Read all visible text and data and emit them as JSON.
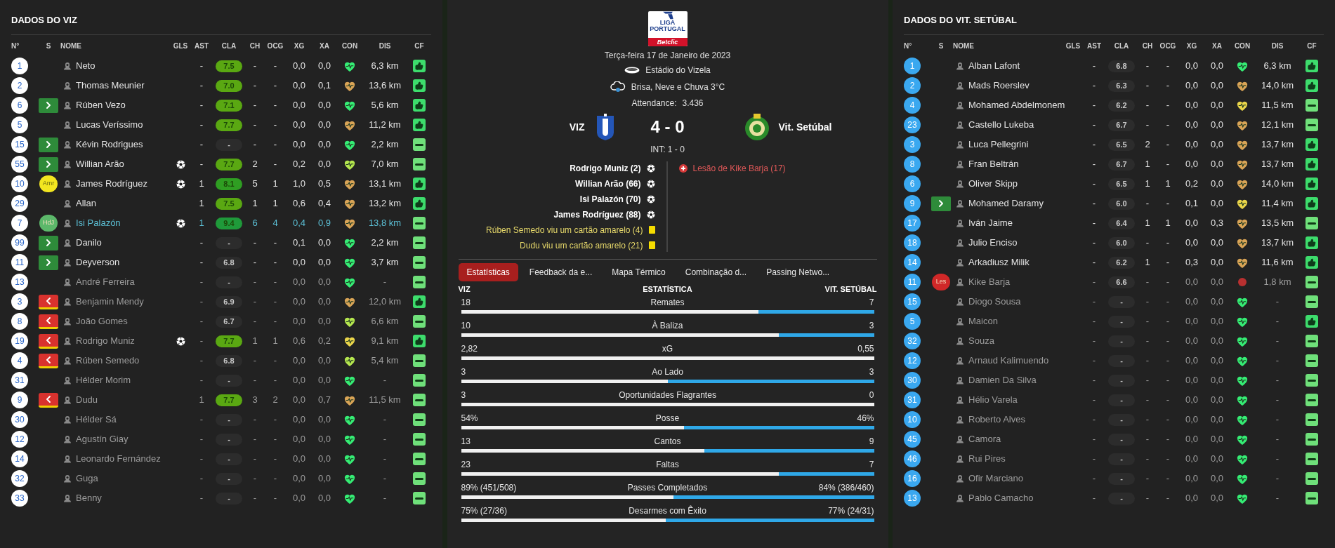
{
  "home_panel": {
    "title": "DADOS DO VIZ",
    "kind": "light",
    "columns": [
      "N°",
      "S",
      "NOME",
      "GLS",
      "AST",
      "CLA",
      "CH",
      "OCG",
      "XG",
      "XA",
      "CON",
      "DIS",
      "CF"
    ],
    "rows": [
      {
        "n": "1",
        "name": "Neto",
        "dimmed": false,
        "highlighted": false,
        "goal": false,
        "booked": false,
        "ast": "-",
        "rating": {
          "text": "7.5",
          "color": "#5aa812"
        },
        "ch": "-",
        "ocg": "-",
        "xg": "0,0",
        "xa": "0,0",
        "condition": {
          "kind": "fresh"
        },
        "dis": "6,3 km",
        "thumbs_up": true
      },
      {
        "n": "2",
        "name": "Thomas Meunier",
        "dimmed": false,
        "highlighted": false,
        "goal": false,
        "booked": false,
        "ast": "-",
        "rating": {
          "text": "7.0",
          "color": "#5aa812"
        },
        "ch": "-",
        "ocg": "-",
        "xg": "0,0",
        "xa": "0,1",
        "condition": {
          "kind": "tired"
        },
        "dis": "13,6 km",
        "thumbs_up": true
      },
      {
        "n": "6",
        "name": "Rúben Vezo",
        "sub": {
          "kind": "in"
        },
        "dimmed": false,
        "highlighted": false,
        "goal": false,
        "booked": false,
        "ast": "-",
        "rating": {
          "text": "7.1",
          "color": "#5aa812"
        },
        "ch": "-",
        "ocg": "-",
        "xg": "0,0",
        "xa": "0,0",
        "condition": {
          "kind": "fresh"
        },
        "dis": "5,6 km",
        "thumbs_up": true
      },
      {
        "n": "5",
        "name": "Lucas Veríssimo",
        "dimmed": false,
        "highlighted": false,
        "goal": false,
        "booked": false,
        "ast": "-",
        "rating": {
          "text": "7.7",
          "color": "#5aa812"
        },
        "ch": "-",
        "ocg": "-",
        "xg": "0,0",
        "xa": "0,0",
        "condition": {
          "kind": "tired"
        },
        "dis": "11,2 km",
        "thumbs_up": true
      },
      {
        "n": "15",
        "name": "Kévin Rodrigues",
        "sub": {
          "kind": "in"
        },
        "dimmed": false,
        "highlighted": false,
        "goal": false,
        "booked": false,
        "ast": "-",
        "rating": {
          "text": "-",
          "color": "#2c2c2c"
        },
        "ch": "-",
        "ocg": "-",
        "xg": "0,0",
        "xa": "0,0",
        "condition": {
          "kind": "fresh"
        },
        "dis": "2,2 km",
        "thumbs_up": false
      },
      {
        "n": "55",
        "name": "Willian Arão",
        "sub": {
          "kind": "in"
        },
        "dimmed": false,
        "highlighted": false,
        "goal": true,
        "booked": false,
        "ast": "-",
        "rating": {
          "text": "7.7",
          "color": "#5aa812"
        },
        "ch": "2",
        "ocg": "-",
        "xg": "0,2",
        "xa": "0,0",
        "condition": {
          "kind": "good"
        },
        "dis": "7,0 km",
        "thumbs_up": false
      },
      {
        "n": "10",
        "name": "James Rodríguez",
        "sub": {
          "kind": "label",
          "label": "Amr",
          "color": "#f2e620"
        },
        "dimmed": false,
        "highlighted": false,
        "goal": true,
        "booked": false,
        "ast": "1",
        "rating": {
          "text": "8.1",
          "color": "#2f9e22"
        },
        "ch": "5",
        "ocg": "1",
        "xg": "1,0",
        "xa": "0,5",
        "condition": {
          "kind": "tired"
        },
        "dis": "13,1 km",
        "thumbs_up": true
      },
      {
        "n": "29",
        "name": "Allan",
        "dimmed": false,
        "highlighted": false,
        "goal": false,
        "booked": false,
        "ast": "1",
        "rating": {
          "text": "7.5",
          "color": "#5aa812"
        },
        "ch": "1",
        "ocg": "1",
        "xg": "0,6",
        "xa": "0,4",
        "condition": {
          "kind": "tired"
        },
        "dis": "13,2 km",
        "thumbs_up": true
      },
      {
        "n": "7",
        "name": "Isi Palazón",
        "sub": {
          "kind": "label",
          "label": "HdJ",
          "color": "#5cb86a"
        },
        "dimmed": false,
        "highlighted": true,
        "goal": true,
        "booked": false,
        "ast": "1",
        "rating": {
          "text": "9.4",
          "color": "#1f9a3a"
        },
        "ch": "6",
        "ocg": "4",
        "xg": "0,4",
        "xa": "0,9",
        "condition": {
          "kind": "tired"
        },
        "dis": "13,8 km",
        "thumbs_up": false
      },
      {
        "n": "99",
        "name": "Danilo",
        "sub": {
          "kind": "in"
        },
        "dimmed": false,
        "highlighted": false,
        "goal": false,
        "booked": false,
        "ast": "-",
        "rating": {
          "text": "-",
          "color": "#2c2c2c"
        },
        "ch": "-",
        "ocg": "-",
        "xg": "0,1",
        "xa": "0,0",
        "condition": {
          "kind": "fresh"
        },
        "dis": "2,2 km",
        "thumbs_up": false
      },
      {
        "n": "11",
        "name": "Deyverson",
        "sub": {
          "kind": "in"
        },
        "dimmed": false,
        "highlighted": false,
        "goal": false,
        "booked": false,
        "ast": "-",
        "rating": {
          "text": "6.8",
          "color": "#2c2c2c"
        },
        "ch": "-",
        "ocg": "-",
        "xg": "0,0",
        "xa": "0,0",
        "condition": {
          "kind": "fresh"
        },
        "dis": "3,7 km",
        "thumbs_up": false
      },
      {
        "n": "13",
        "name": "André Ferreira",
        "dimmed": true,
        "highlighted": false,
        "goal": false,
        "booked": false,
        "ast": "-",
        "rating": {
          "text": "-",
          "color": "#2c2c2c"
        },
        "ch": "-",
        "ocg": "-",
        "xg": "0,0",
        "xa": "0,0",
        "condition": {
          "kind": "fresh"
        },
        "dis": "-",
        "thumbs_up": false
      },
      {
        "n": "3",
        "name": "Benjamin Mendy",
        "sub": {
          "kind": "out"
        },
        "dimmed": true,
        "highlighted": false,
        "goal": false,
        "booked": true,
        "ast": "-",
        "rating": {
          "text": "6.9",
          "color": "#2c2c2c"
        },
        "ch": "-",
        "ocg": "-",
        "xg": "0,0",
        "xa": "0,0",
        "condition": {
          "kind": "tired"
        },
        "dis": "12,0 km",
        "thumbs_up": true
      },
      {
        "n": "8",
        "name": "João Gomes",
        "sub": {
          "kind": "out"
        },
        "dimmed": true,
        "highlighted": false,
        "goal": false,
        "booked": true,
        "ast": "-",
        "rating": {
          "text": "6.7",
          "color": "#2c2c2c"
        },
        "ch": "-",
        "ocg": "-",
        "xg": "0,0",
        "xa": "0,0",
        "condition": {
          "kind": "good"
        },
        "dis": "6,6 km",
        "thumbs_up": false
      },
      {
        "n": "19",
        "name": "Rodrigo Muniz",
        "sub": {
          "kind": "out"
        },
        "dimmed": true,
        "highlighted": false,
        "goal": true,
        "booked": true,
        "ast": "-",
        "rating": {
          "text": "7.7",
          "color": "#5aa812"
        },
        "ch": "1",
        "ocg": "1",
        "xg": "0,6",
        "xa": "0,2",
        "condition": {
          "kind": "fair"
        },
        "dis": "9,1 km",
        "thumbs_up": true
      },
      {
        "n": "4",
        "name": "Rúben Semedo",
        "sub": {
          "kind": "out"
        },
        "dimmed": true,
        "highlighted": false,
        "goal": false,
        "booked": true,
        "ast": "-",
        "rating": {
          "text": "6.8",
          "color": "#2c2c2c"
        },
        "ch": "-",
        "ocg": "-",
        "xg": "0,0",
        "xa": "0,0",
        "condition": {
          "kind": "good"
        },
        "dis": "5,4 km",
        "thumbs_up": false
      },
      {
        "n": "31",
        "name": "Hélder Morim",
        "dimmed": true,
        "highlighted": false,
        "goal": false,
        "booked": false,
        "ast": "-",
        "rating": {
          "text": "-",
          "color": "#2c2c2c"
        },
        "ch": "-",
        "ocg": "-",
        "xg": "0,0",
        "xa": "0,0",
        "condition": {
          "kind": "fresh"
        },
        "dis": "-",
        "thumbs_up": false
      },
      {
        "n": "9",
        "name": "Dudu",
        "sub": {
          "kind": "out"
        },
        "dimmed": true,
        "highlighted": false,
        "goal": false,
        "booked": true,
        "ast": "1",
        "rating": {
          "text": "7.7",
          "color": "#5aa812"
        },
        "ch": "3",
        "ocg": "2",
        "xg": "0,0",
        "xa": "0,7",
        "condition": {
          "kind": "tired"
        },
        "dis": "11,5 km",
        "thumbs_up": false
      },
      {
        "n": "30",
        "name": "Hélder Sá",
        "dimmed": true,
        "highlighted": false,
        "goal": false,
        "booked": false,
        "ast": "-",
        "rating": {
          "text": "-",
          "color": "#2c2c2c"
        },
        "ch": "-",
        "ocg": "-",
        "xg": "0,0",
        "xa": "0,0",
        "condition": {
          "kind": "fresh"
        },
        "dis": "-",
        "thumbs_up": false
      },
      {
        "n": "12",
        "name": "Agustín Giay",
        "dimmed": true,
        "highlighted": false,
        "goal": false,
        "booked": false,
        "ast": "-",
        "rating": {
          "text": "-",
          "color": "#2c2c2c"
        },
        "ch": "-",
        "ocg": "-",
        "xg": "0,0",
        "xa": "0,0",
        "condition": {
          "kind": "fresh"
        },
        "dis": "-",
        "thumbs_up": false
      },
      {
        "n": "14",
        "name": "Leonardo Fernández",
        "dimmed": true,
        "highlighted": false,
        "goal": false,
        "booked": false,
        "ast": "-",
        "rating": {
          "text": "-",
          "color": "#2c2c2c"
        },
        "ch": "-",
        "ocg": "-",
        "xg": "0,0",
        "xa": "0,0",
        "condition": {
          "kind": "fresh"
        },
        "dis": "-",
        "thumbs_up": false
      },
      {
        "n": "32",
        "name": "Guga",
        "dimmed": true,
        "highlighted": false,
        "goal": false,
        "booked": false,
        "ast": "-",
        "rating": {
          "text": "-",
          "color": "#2c2c2c"
        },
        "ch": "-",
        "ocg": "-",
        "xg": "0,0",
        "xa": "0,0",
        "condition": {
          "kind": "fresh"
        },
        "dis": "-",
        "thumbs_up": false
      },
      {
        "n": "33",
        "name": "Benny",
        "dimmed": true,
        "highlighted": false,
        "goal": false,
        "booked": false,
        "ast": "-",
        "rating": {
          "text": "-",
          "color": "#2c2c2c"
        },
        "ch": "-",
        "ocg": "-",
        "xg": "0,0",
        "xa": "0,0",
        "condition": {
          "kind": "fresh"
        },
        "dis": "-",
        "thumbs_up": false
      }
    ]
  },
  "match": {
    "logo_text": [
      "LIGA",
      "PORTUGAL"
    ],
    "logo_brand": "Betclic",
    "date": "Terça-feira 17 de Janeiro de 2023",
    "stadium": "Estádio do Vizela",
    "weather": "Brisa, Neve e Chuva 3°C",
    "attendance_label": "Attendance:",
    "attendance": "3.436",
    "home": "VIZ",
    "score": "4 - 0",
    "away": "Vit. Setúbal",
    "halftime": "INT: 1 - 0",
    "home_events": [
      {
        "kind": "goal",
        "text": "Rodrigo Muniz (2)"
      },
      {
        "kind": "goal",
        "text": "Willian Arão (66)"
      },
      {
        "kind": "goal",
        "text": "Isi Palazón (70)"
      },
      {
        "kind": "goal",
        "text": "James Rodríguez (88)"
      },
      {
        "kind": "yellow",
        "text": "Rúben Semedo viu um cartão amarelo (4)"
      },
      {
        "kind": "yellow",
        "text": "Dudu viu um cartão amarelo (21)"
      }
    ],
    "away_events": [
      {
        "kind": "injury",
        "text": "Lesão de Kike Barja (17)"
      }
    ]
  },
  "tabs": [
    {
      "label": "Estatísticas",
      "selected": true
    },
    {
      "label": "Feedback da e...",
      "selected": false
    },
    {
      "label": "Mapa Térmico",
      "selected": false
    },
    {
      "label": "Combinação d...",
      "selected": false
    },
    {
      "label": "Passing Netwo...",
      "selected": false
    }
  ],
  "stats": {
    "home_header": "VIZ",
    "header": "ESTATÍSTICA",
    "away_header": "VIT. SETÚBAL",
    "rows": [
      {
        "home": "18",
        "label": "Remates",
        "away": "7",
        "level": 0.72
      },
      {
        "home": "10",
        "label": "À Baliza",
        "away": "3",
        "level": 0.77
      },
      {
        "home": "2,82",
        "label": "xG",
        "away": "0,55",
        "level": 1
      },
      {
        "home": "3",
        "label": "Ao Lado",
        "away": "3",
        "level": 0.5
      },
      {
        "home": "3",
        "label": "Oportunidades Flagrantes",
        "away": "0",
        "level": 1
      },
      {
        "home": "54%",
        "label": "Posse",
        "away": "46%",
        "level": 0.54
      },
      {
        "home": "13",
        "label": "Cantos",
        "away": "9",
        "level": 0.59
      },
      {
        "home": "23",
        "label": "Faltas",
        "away": "7",
        "level": 0.77
      },
      {
        "home": "89% (451/508)",
        "label": "Passes Completados",
        "away": "84% (386/460)",
        "level": 0.515
      },
      {
        "home": "75% (27/36)",
        "label": "Desarmes com Êxito",
        "away": "77% (24/31)",
        "level": 0.495
      }
    ]
  },
  "away_panel": {
    "title": "DADOS DO VIT. SETÚBAL",
    "kind": "blue",
    "columns": [
      "N°",
      "S",
      "NOME",
      "GLS",
      "AST",
      "CLA",
      "CH",
      "OCG",
      "XG",
      "XA",
      "CON",
      "DIS",
      "CF"
    ],
    "rows": [
      {
        "n": "1",
        "name": "Alban Lafont",
        "dimmed": false,
        "highlighted": false,
        "goal": false,
        "booked": false,
        "ast": "-",
        "rating": {
          "text": "6.8",
          "color": "#2c2c2c"
        },
        "ch": "-",
        "ocg": "-",
        "xg": "0,0",
        "xa": "0,0",
        "condition": {
          "kind": "fresh"
        },
        "dis": "6,3 km",
        "thumbs_up": true
      },
      {
        "n": "2",
        "name": "Mads Roerslev",
        "dimmed": false,
        "highlighted": false,
        "goal": false,
        "booked": false,
        "ast": "-",
        "rating": {
          "text": "6.3",
          "color": "#2c2c2c"
        },
        "ch": "-",
        "ocg": "-",
        "xg": "0,0",
        "xa": "0,0",
        "condition": {
          "kind": "tired"
        },
        "dis": "14,0 km",
        "thumbs_up": true
      },
      {
        "n": "4",
        "name": "Mohamed Abdelmonem",
        "dimmed": false,
        "highlighted": false,
        "goal": false,
        "booked": false,
        "ast": "-",
        "rating": {
          "text": "6.2",
          "color": "#2c2c2c"
        },
        "ch": "-",
        "ocg": "-",
        "xg": "0,0",
        "xa": "0,0",
        "condition": {
          "kind": "fair"
        },
        "dis": "11,5 km",
        "thumbs_up": false
      },
      {
        "n": "23",
        "name": "Castello Lukeba",
        "dimmed": false,
        "highlighted": false,
        "goal": false,
        "booked": false,
        "ast": "-",
        "rating": {
          "text": "6.7",
          "color": "#2c2c2c"
        },
        "ch": "-",
        "ocg": "-",
        "xg": "0,0",
        "xa": "0,0",
        "condition": {
          "kind": "tired"
        },
        "dis": "12,1 km",
        "thumbs_up": false
      },
      {
        "n": "3",
        "name": "Luca Pellegrini",
        "dimmed": false,
        "highlighted": false,
        "goal": false,
        "booked": false,
        "ast": "-",
        "rating": {
          "text": "6.5",
          "color": "#2c2c2c"
        },
        "ch": "2",
        "ocg": "-",
        "xg": "0,0",
        "xa": "0,0",
        "condition": {
          "kind": "tired"
        },
        "dis": "13,7 km",
        "thumbs_up": true
      },
      {
        "n": "8",
        "name": "Fran Beltrán",
        "dimmed": false,
        "highlighted": false,
        "goal": false,
        "booked": false,
        "ast": "-",
        "rating": {
          "text": "6.7",
          "color": "#2c2c2c"
        },
        "ch": "1",
        "ocg": "-",
        "xg": "0,0",
        "xa": "0,0",
        "condition": {
          "kind": "tired"
        },
        "dis": "13,7 km",
        "thumbs_up": true
      },
      {
        "n": "6",
        "name": "Oliver Skipp",
        "dimmed": false,
        "highlighted": false,
        "goal": false,
        "booked": false,
        "ast": "-",
        "rating": {
          "text": "6.5",
          "color": "#2c2c2c"
        },
        "ch": "1",
        "ocg": "1",
        "xg": "0,2",
        "xa": "0,0",
        "condition": {
          "kind": "tired"
        },
        "dis": "14,0 km",
        "thumbs_up": true
      },
      {
        "n": "9",
        "name": "Mohamed Daramy",
        "sub": {
          "kind": "in"
        },
        "dimmed": false,
        "highlighted": false,
        "goal": false,
        "booked": false,
        "ast": "-",
        "rating": {
          "text": "6.0",
          "color": "#2c2c2c"
        },
        "ch": "-",
        "ocg": "-",
        "xg": "0,1",
        "xa": "0,0",
        "condition": {
          "kind": "fair"
        },
        "dis": "11,4 km",
        "thumbs_up": true
      },
      {
        "n": "17",
        "name": "Iván Jaime",
        "dimmed": false,
        "highlighted": false,
        "goal": false,
        "booked": false,
        "ast": "-",
        "rating": {
          "text": "6.4",
          "color": "#2c2c2c"
        },
        "ch": "1",
        "ocg": "1",
        "xg": "0,0",
        "xa": "0,3",
        "condition": {
          "kind": "tired"
        },
        "dis": "13,5 km",
        "thumbs_up": false
      },
      {
        "n": "18",
        "name": "Julio Enciso",
        "dimmed": false,
        "highlighted": false,
        "goal": false,
        "booked": false,
        "ast": "-",
        "rating": {
          "text": "6.0",
          "color": "#2c2c2c"
        },
        "ch": "-",
        "ocg": "-",
        "xg": "0,0",
        "xa": "0,0",
        "condition": {
          "kind": "tired"
        },
        "dis": "13,7 km",
        "thumbs_up": true
      },
      {
        "n": "14",
        "name": "Arkadiusz Milik",
        "dimmed": false,
        "highlighted": false,
        "goal": false,
        "booked": false,
        "ast": "-",
        "rating": {
          "text": "6.2",
          "color": "#2c2c2c"
        },
        "ch": "1",
        "ocg": "-",
        "xg": "0,3",
        "xa": "0,0",
        "condition": {
          "kind": "tired"
        },
        "dis": "11,6 km",
        "thumbs_up": true
      },
      {
        "n": "11",
        "name": "Kike Barja",
        "sub": {
          "kind": "label",
          "label": "Les",
          "color": "#d02828"
        },
        "dimmed": true,
        "highlighted": false,
        "goal": false,
        "booked": false,
        "ast": "-",
        "rating": {
          "text": "6.6",
          "color": "#2c2c2c"
        },
        "ch": "-",
        "ocg": "-",
        "xg": "0,0",
        "xa": "0,0",
        "condition": {
          "kind": "injured"
        },
        "dis": "1,8 km",
        "thumbs_up": false
      },
      {
        "n": "15",
        "name": "Diogo Sousa",
        "dimmed": true,
        "highlighted": false,
        "goal": false,
        "booked": false,
        "ast": "-",
        "rating": {
          "text": "-",
          "color": "#2c2c2c"
        },
        "ch": "-",
        "ocg": "-",
        "xg": "0,0",
        "xa": "0,0",
        "condition": {
          "kind": "fresh"
        },
        "dis": "-",
        "thumbs_up": false
      },
      {
        "n": "5",
        "name": "Maicon",
        "dimmed": true,
        "highlighted": false,
        "goal": false,
        "booked": false,
        "ast": "-",
        "rating": {
          "text": "-",
          "color": "#2c2c2c"
        },
        "ch": "-",
        "ocg": "-",
        "xg": "0,0",
        "xa": "0,0",
        "condition": {
          "kind": "fresh"
        },
        "dis": "-",
        "thumbs_up": true
      },
      {
        "n": "32",
        "name": "Souza",
        "dimmed": true,
        "highlighted": false,
        "goal": false,
        "booked": false,
        "ast": "-",
        "rating": {
          "text": "-",
          "color": "#2c2c2c"
        },
        "ch": "-",
        "ocg": "-",
        "xg": "0,0",
        "xa": "0,0",
        "condition": {
          "kind": "fresh"
        },
        "dis": "-",
        "thumbs_up": false
      },
      {
        "n": "12",
        "name": "Arnaud Kalimuendo",
        "dimmed": true,
        "highlighted": false,
        "goal": false,
        "booked": false,
        "ast": "-",
        "rating": {
          "text": "-",
          "color": "#2c2c2c"
        },
        "ch": "-",
        "ocg": "-",
        "xg": "0,0",
        "xa": "0,0",
        "condition": {
          "kind": "fresh"
        },
        "dis": "-",
        "thumbs_up": false
      },
      {
        "n": "30",
        "name": "Damien Da Silva",
        "dimmed": true,
        "highlighted": false,
        "goal": false,
        "booked": false,
        "ast": "-",
        "rating": {
          "text": "-",
          "color": "#2c2c2c"
        },
        "ch": "-",
        "ocg": "-",
        "xg": "0,0",
        "xa": "0,0",
        "condition": {
          "kind": "fresh"
        },
        "dis": "-",
        "thumbs_up": false
      },
      {
        "n": "31",
        "name": "Hélio Varela",
        "dimmed": true,
        "highlighted": false,
        "goal": false,
        "booked": false,
        "ast": "-",
        "rating": {
          "text": "-",
          "color": "#2c2c2c"
        },
        "ch": "-",
        "ocg": "-",
        "xg": "0,0",
        "xa": "0,0",
        "condition": {
          "kind": "fresh"
        },
        "dis": "-",
        "thumbs_up": false
      },
      {
        "n": "10",
        "name": "Roberto Alves",
        "dimmed": true,
        "highlighted": false,
        "goal": false,
        "booked": false,
        "ast": "-",
        "rating": {
          "text": "-",
          "color": "#2c2c2c"
        },
        "ch": "-",
        "ocg": "-",
        "xg": "0,0",
        "xa": "0,0",
        "condition": {
          "kind": "fresh"
        },
        "dis": "-",
        "thumbs_up": false
      },
      {
        "n": "45",
        "name": "Camora",
        "dimmed": true,
        "highlighted": false,
        "goal": false,
        "booked": false,
        "ast": "-",
        "rating": {
          "text": "-",
          "color": "#2c2c2c"
        },
        "ch": "-",
        "ocg": "-",
        "xg": "0,0",
        "xa": "0,0",
        "condition": {
          "kind": "fresh"
        },
        "dis": "-",
        "thumbs_up": false
      },
      {
        "n": "46",
        "name": "Rui Pires",
        "dimmed": true,
        "highlighted": false,
        "goal": false,
        "booked": false,
        "ast": "-",
        "rating": {
          "text": "-",
          "color": "#2c2c2c"
        },
        "ch": "-",
        "ocg": "-",
        "xg": "0,0",
        "xa": "0,0",
        "condition": {
          "kind": "fresh"
        },
        "dis": "-",
        "thumbs_up": false
      },
      {
        "n": "16",
        "name": "Ofir Marciano",
        "dimmed": true,
        "highlighted": false,
        "goal": false,
        "booked": false,
        "ast": "-",
        "rating": {
          "text": "-",
          "color": "#2c2c2c"
        },
        "ch": "-",
        "ocg": "-",
        "xg": "0,0",
        "xa": "0,0",
        "condition": {
          "kind": "fresh"
        },
        "dis": "-",
        "thumbs_up": false
      },
      {
        "n": "13",
        "name": "Pablo Camacho",
        "dimmed": true,
        "highlighted": false,
        "goal": false,
        "booked": false,
        "ast": "-",
        "rating": {
          "text": "-",
          "color": "#2c2c2c"
        },
        "ch": "-",
        "ocg": "-",
        "xg": "0,0",
        "xa": "0,0",
        "condition": {
          "kind": "fresh"
        },
        "dis": "-",
        "thumbs_up": false
      }
    ]
  }
}
